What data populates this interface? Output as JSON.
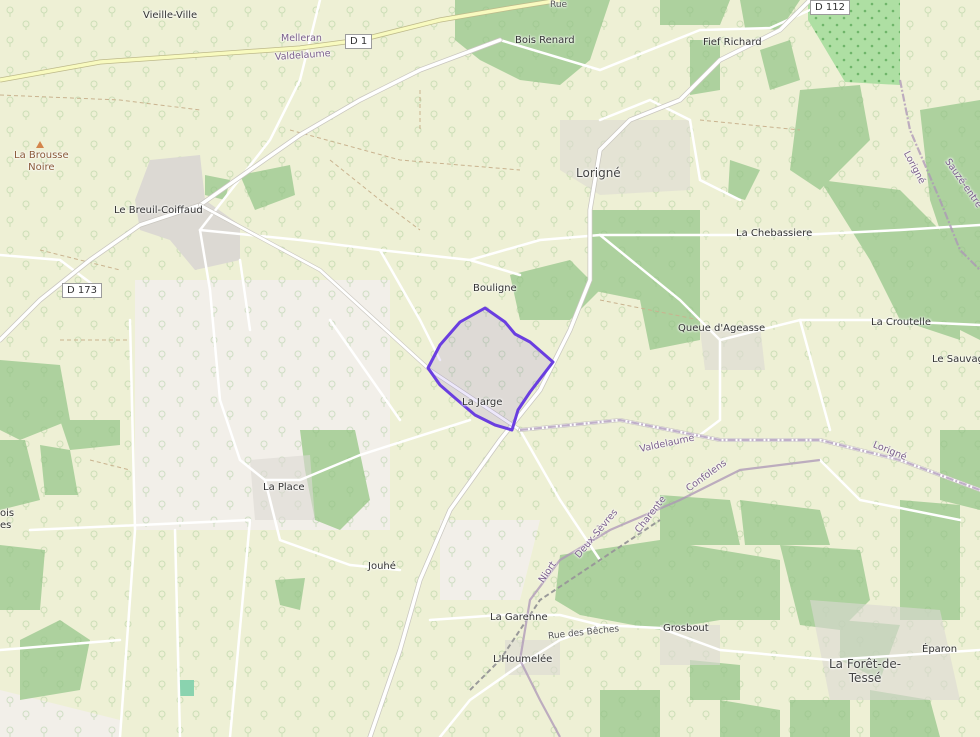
{
  "map": {
    "places": {
      "vieille_ville": "Vieille-Ville",
      "bois_renard": "Bois Renard",
      "fief_richard": "Fief Richard",
      "la_brousse_noire": "La Brousse\nNoire",
      "le_breuil_coiffaud": "Le Breuil-Coiffaud",
      "lorigne": "Lorigné",
      "la_chebassiere": "La Chebassiere",
      "bouligne": "Bouligne",
      "queue_dageasse": "Queue d'Ageasse",
      "la_croutelle": "La Croutelle",
      "le_sauvage": "Le Sauvag",
      "la_jarge": "La Jarge",
      "la_place": "La Place",
      "jouhe": "Jouhé",
      "la_garenne": "La Garenne",
      "grosbout": "Grosbout",
      "lhoumelee": "L'Houmelée",
      "la_foret_de_tesse": "La Forêt-de-\nTessé",
      "eparon": "Éparon",
      "edge_left": "ois\nes"
    },
    "roads": {
      "d1": "D 1",
      "d112": "D 112",
      "d173": "D 173",
      "rue_top": "Rue",
      "rue_des_beches": "Rue des Bêches"
    },
    "boundary_labels": {
      "melleran": "Melleran",
      "valdelaume_top": "Valdelaume",
      "valdelaume_mid": "Valdelaume",
      "lorigne_right": "Lorigné",
      "lorigne_vertical": "Lorigné",
      "sauze": "Sauzé-entre",
      "confolens": "Confolens",
      "charente": "Charente",
      "niort": "Niort",
      "deux_sevres": "Deux-Sèvres"
    },
    "colors": {
      "background": "#f2efe9",
      "farmland": "#eef0d5",
      "forest": "#add19e",
      "road": "#ffffff",
      "primary_road": "#f8fabf",
      "boundary": "#ac96b7",
      "highlight": "#6a3ee0",
      "highlight_fill": "#6a3ee0",
      "orchard": "#aedfa3"
    },
    "icons": [
      "peak-icon",
      "tree-icon"
    ]
  }
}
